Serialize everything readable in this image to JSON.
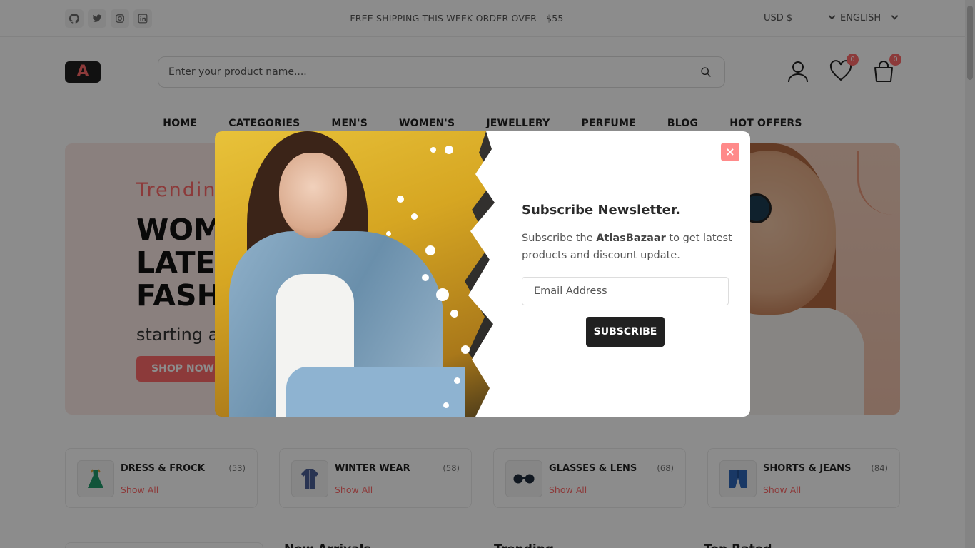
{
  "topbar": {
    "social": [
      "github",
      "twitter",
      "instagram",
      "linkedin"
    ],
    "shipping_text": "FREE SHIPPING THIS WEEK ORDER OVER - $55",
    "currency": "USD $",
    "language": "ENGLISH"
  },
  "header": {
    "logo_letter": "A",
    "search_placeholder": "Enter your product name....",
    "wishlist_count": "0",
    "cart_count": "0"
  },
  "nav": [
    "HOME",
    "CATEGORIES",
    "MEN'S",
    "WOMEN'S",
    "JEWELLERY",
    "PERFUME",
    "BLOG",
    "HOT OFFERS"
  ],
  "hero": {
    "trending": "Trendin",
    "headline_1": "WOM",
    "headline_2": "LATES",
    "headline_3": "FASH",
    "starting": "starting a",
    "cta": "SHOP NOW"
  },
  "categories": [
    {
      "name": "DRESS & FROCK",
      "count": "(53)",
      "link": "Show All"
    },
    {
      "name": "WINTER WEAR",
      "count": "(58)",
      "link": "Show All"
    },
    {
      "name": "GLASSES & LENS",
      "count": "(68)",
      "link": "Show All"
    },
    {
      "name": "SHORTS & JEANS",
      "count": "(84)",
      "link": "Show All"
    }
  ],
  "sections": [
    "New Arrivals",
    "Trending",
    "Top Rated"
  ],
  "modal": {
    "close_label": "×",
    "title": "Subscribe Newsletter.",
    "desc_pre": "Subscribe the ",
    "desc_brand": "AtlasBazaar",
    "desc_post": " to get latest products and discount update.",
    "email_placeholder": "Email Address",
    "subscribe_label": "SUBSCRIBE"
  },
  "colors": {
    "accent": "#ff6b6b",
    "dark": "#212121"
  }
}
